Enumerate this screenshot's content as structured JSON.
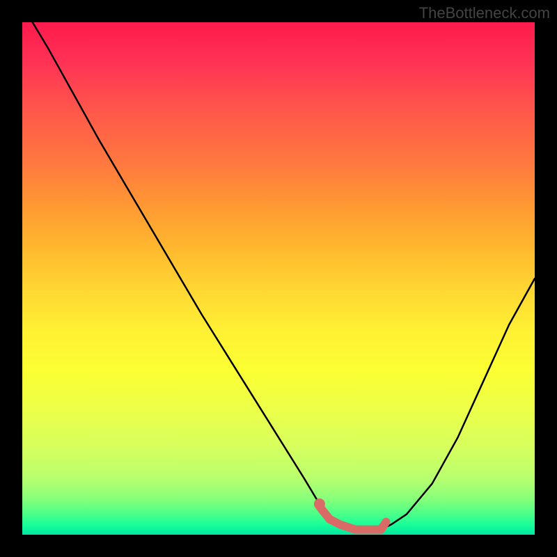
{
  "watermark": "TheBottleneck.com",
  "chart_data": {
    "type": "line",
    "title": "",
    "xlabel": "",
    "ylabel": "",
    "xlim": [
      0,
      100
    ],
    "ylim": [
      0,
      100
    ],
    "series": [
      {
        "name": "bottleneck-curve",
        "color": "#000000",
        "x": [
          2,
          5,
          10,
          15,
          20,
          25,
          30,
          35,
          40,
          45,
          50,
          55,
          58,
          60,
          62,
          65,
          68,
          70,
          72,
          75,
          80,
          85,
          90,
          95,
          100
        ],
        "y": [
          100,
          95,
          86,
          77,
          68.5,
          60,
          51.5,
          43,
          35,
          27,
          19,
          11,
          6,
          3.5,
          2,
          1,
          1,
          1,
          2,
          4,
          10,
          19,
          30,
          41,
          50
        ]
      },
      {
        "name": "highlight-band",
        "color": "#d96a66",
        "stroke_width": 12,
        "x": [
          58,
          60,
          62,
          65,
          68,
          70,
          71
        ],
        "y": [
          5.5,
          3.0,
          2.0,
          1.0,
          1.0,
          1.0,
          2.5
        ]
      },
      {
        "name": "highlight-dot",
        "type": "scatter",
        "color": "#d96a66",
        "x": [
          58
        ],
        "y": [
          6
        ]
      }
    ]
  }
}
